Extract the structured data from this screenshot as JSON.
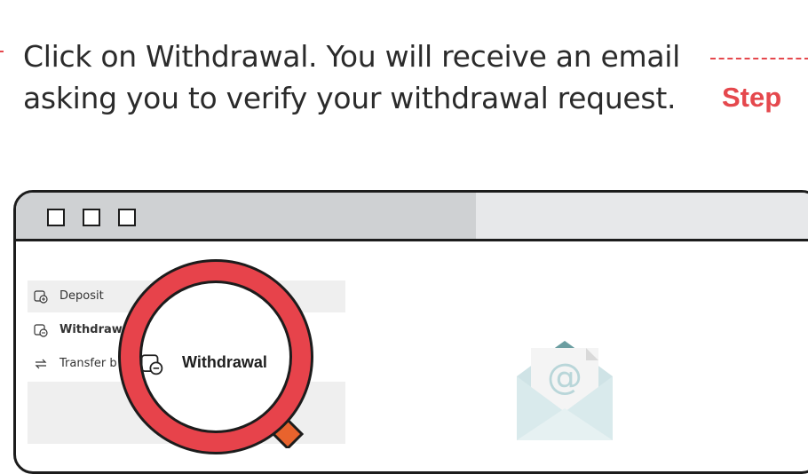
{
  "instruction": {
    "line1": "Click on Withdrawal. You will receive an email",
    "line2": "asking you to verify your withdrawal request."
  },
  "step": {
    "label": "Step"
  },
  "menu": {
    "items": [
      {
        "label": "Deposit",
        "icon": "deposit-icon"
      },
      {
        "label": "Withdrawa",
        "icon": "withdrawal-icon"
      },
      {
        "label": "Transfer b",
        "icon": "transfer-icon"
      }
    ]
  },
  "magnifier": {
    "label": "Withdrawal",
    "icon": "withdrawal-icon"
  },
  "email": {
    "icon": "email-envelope-icon",
    "symbol": "@"
  },
  "colors": {
    "accent": "#e5484d",
    "lens": "#e7434b",
    "titlebar": "#cfd1d3",
    "envelope": "#cfe3e6"
  }
}
